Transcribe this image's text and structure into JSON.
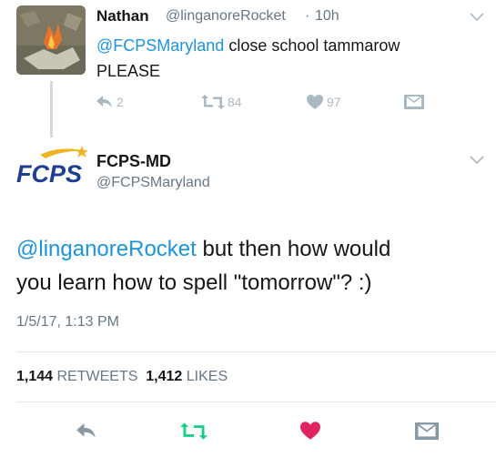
{
  "reply": {
    "name": "Nathan",
    "handle": "@linganoreRocket",
    "separator": "·",
    "time": "10h",
    "mention": "@FCPSMaryland",
    "text_line1_rest": " close school tammarow",
    "text_line2": "PLEASE",
    "reply_count": "2",
    "retweet_count": "84",
    "like_count": "97"
  },
  "original": {
    "logo_text": "FCPS",
    "name": "FCPS-MD",
    "handle": "@FCPSMaryland",
    "mention": "@linganoreRocket",
    "text_line1_rest": " but then how would",
    "text_line2": "you learn how to spell \"tomorrow\"? :)",
    "timestamp": "1/5/17, 1:13 PM",
    "retweets_value": "1,144",
    "retweets_label": "RETWEETS",
    "likes_value": "1,412",
    "likes_label": "LIKES"
  },
  "colors": {
    "link": "#1b95e0",
    "like_heart": "#e0245e",
    "retweet_green": "#19cf86",
    "muted": "#657786"
  },
  "icons": [
    "reply-icon",
    "retweet-icon",
    "like-icon",
    "direct-message-icon",
    "chevron-down-icon"
  ]
}
